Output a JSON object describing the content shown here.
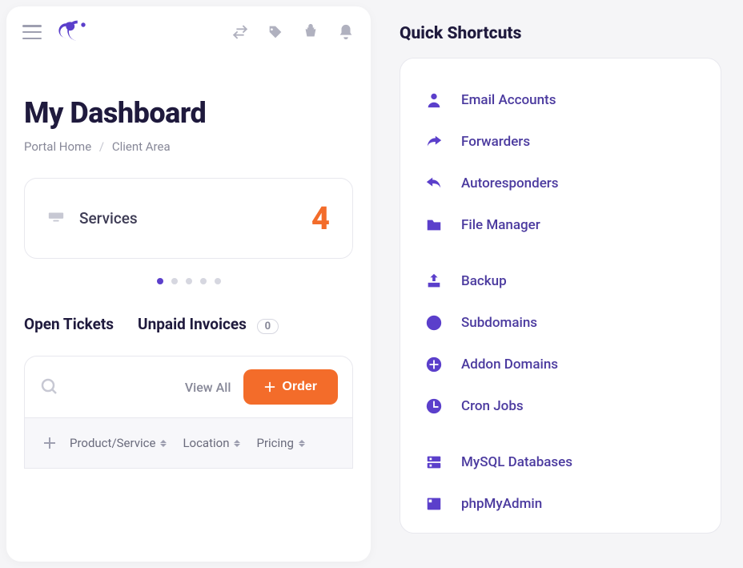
{
  "page": {
    "title": "My Dashboard",
    "breadcrumb": {
      "home": "Portal Home",
      "current": "Client Area"
    }
  },
  "card": {
    "label": "Services",
    "value": "4"
  },
  "tabs": {
    "open_tickets": "Open Tickets",
    "unpaid_invoices": "Unpaid Invoices",
    "unpaid_count": "0"
  },
  "toolbar": {
    "view_all": "View All",
    "order": "Order"
  },
  "table": {
    "col1": "Product/Service",
    "col2": "Location",
    "col3": "Pricing"
  },
  "shortcuts": {
    "title": "Quick Shortcuts",
    "items": [
      {
        "label": "Email Accounts"
      },
      {
        "label": "Forwarders"
      },
      {
        "label": "Autoresponders"
      },
      {
        "label": "File Manager"
      },
      {
        "label": "Backup"
      },
      {
        "label": "Subdomains"
      },
      {
        "label": "Addon Domains"
      },
      {
        "label": "Cron Jobs"
      },
      {
        "label": "MySQL Databases"
      },
      {
        "label": "phpMyAdmin"
      }
    ]
  }
}
